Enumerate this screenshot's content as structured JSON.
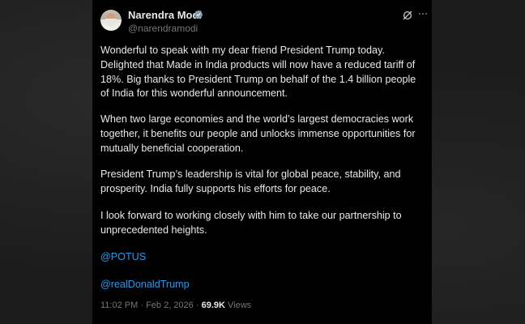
{
  "tweet": {
    "author": {
      "display_name": "Narendra Modi",
      "handle": "@narendramodi"
    },
    "paragraphs": [
      "Wonderful to speak with my dear friend President Trump today. Delighted that Made in India products will now have a reduced tariff of 18%. Big thanks to President Trump on behalf of the 1.4 billion people of India for this wonderful announcement.",
      "When two large economies and the world’s largest democracies work together, it benefits our people and unlocks immense opportunities for mutually beneficial cooperation.",
      "President Trump’s leadership is vital for global peace, stability, and prosperity. India fully supports his efforts for peace.",
      "I look forward to working closely with him to take our partnership to unprecedented heights."
    ],
    "mentions": [
      "@POTUS",
      "@realDonaldTrump"
    ],
    "time": "11:02 PM",
    "separator": "·",
    "date": "Feb 2, 2026",
    "views_count": "69.9K",
    "views_label": "Views"
  },
  "icons": {
    "verified": "verified-badge-icon",
    "grok": "grok-icon",
    "more": "more-icon"
  },
  "colors": {
    "card_background": "#000000",
    "text": "#e7e9ea",
    "muted": "#71767b",
    "link": "#1d9bf0",
    "verified_badge": "#829aab"
  }
}
